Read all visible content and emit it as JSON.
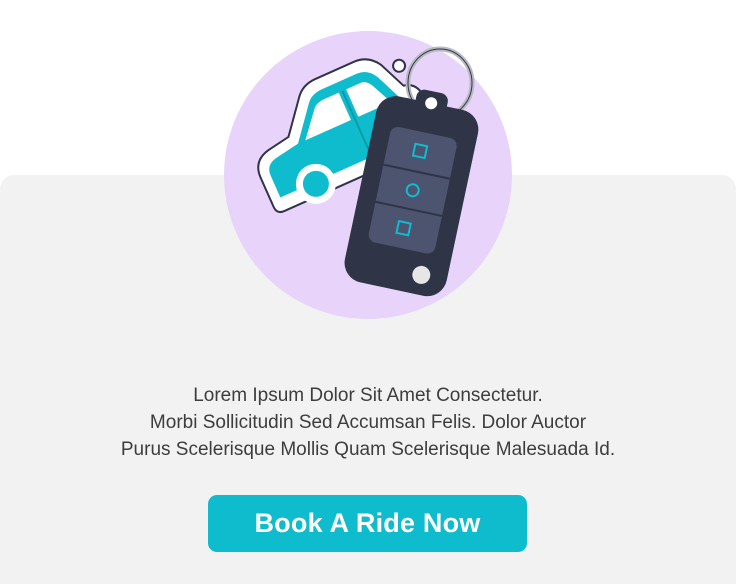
{
  "description": {
    "line1": "Lorem Ipsum Dolor Sit Amet Consectetur.",
    "line2": "Morbi Sollicitudin Sed Accumsan Felis. Dolor Auctor",
    "line3": "Purus Scelerisque Mollis Quam Scelerisque Malesuada Id."
  },
  "cta": {
    "label": "Book A Ride Now"
  },
  "illustration": {
    "icons": [
      "car-keychain-icon",
      "car-icon",
      "key-fob-icon",
      "key-ring-icon"
    ]
  },
  "colors": {
    "accent": "#0fbccd",
    "circle": "#e8d4fb",
    "fob": "#2f3447",
    "card_background": "#f2f2f2",
    "text": "#3d3d3d"
  }
}
